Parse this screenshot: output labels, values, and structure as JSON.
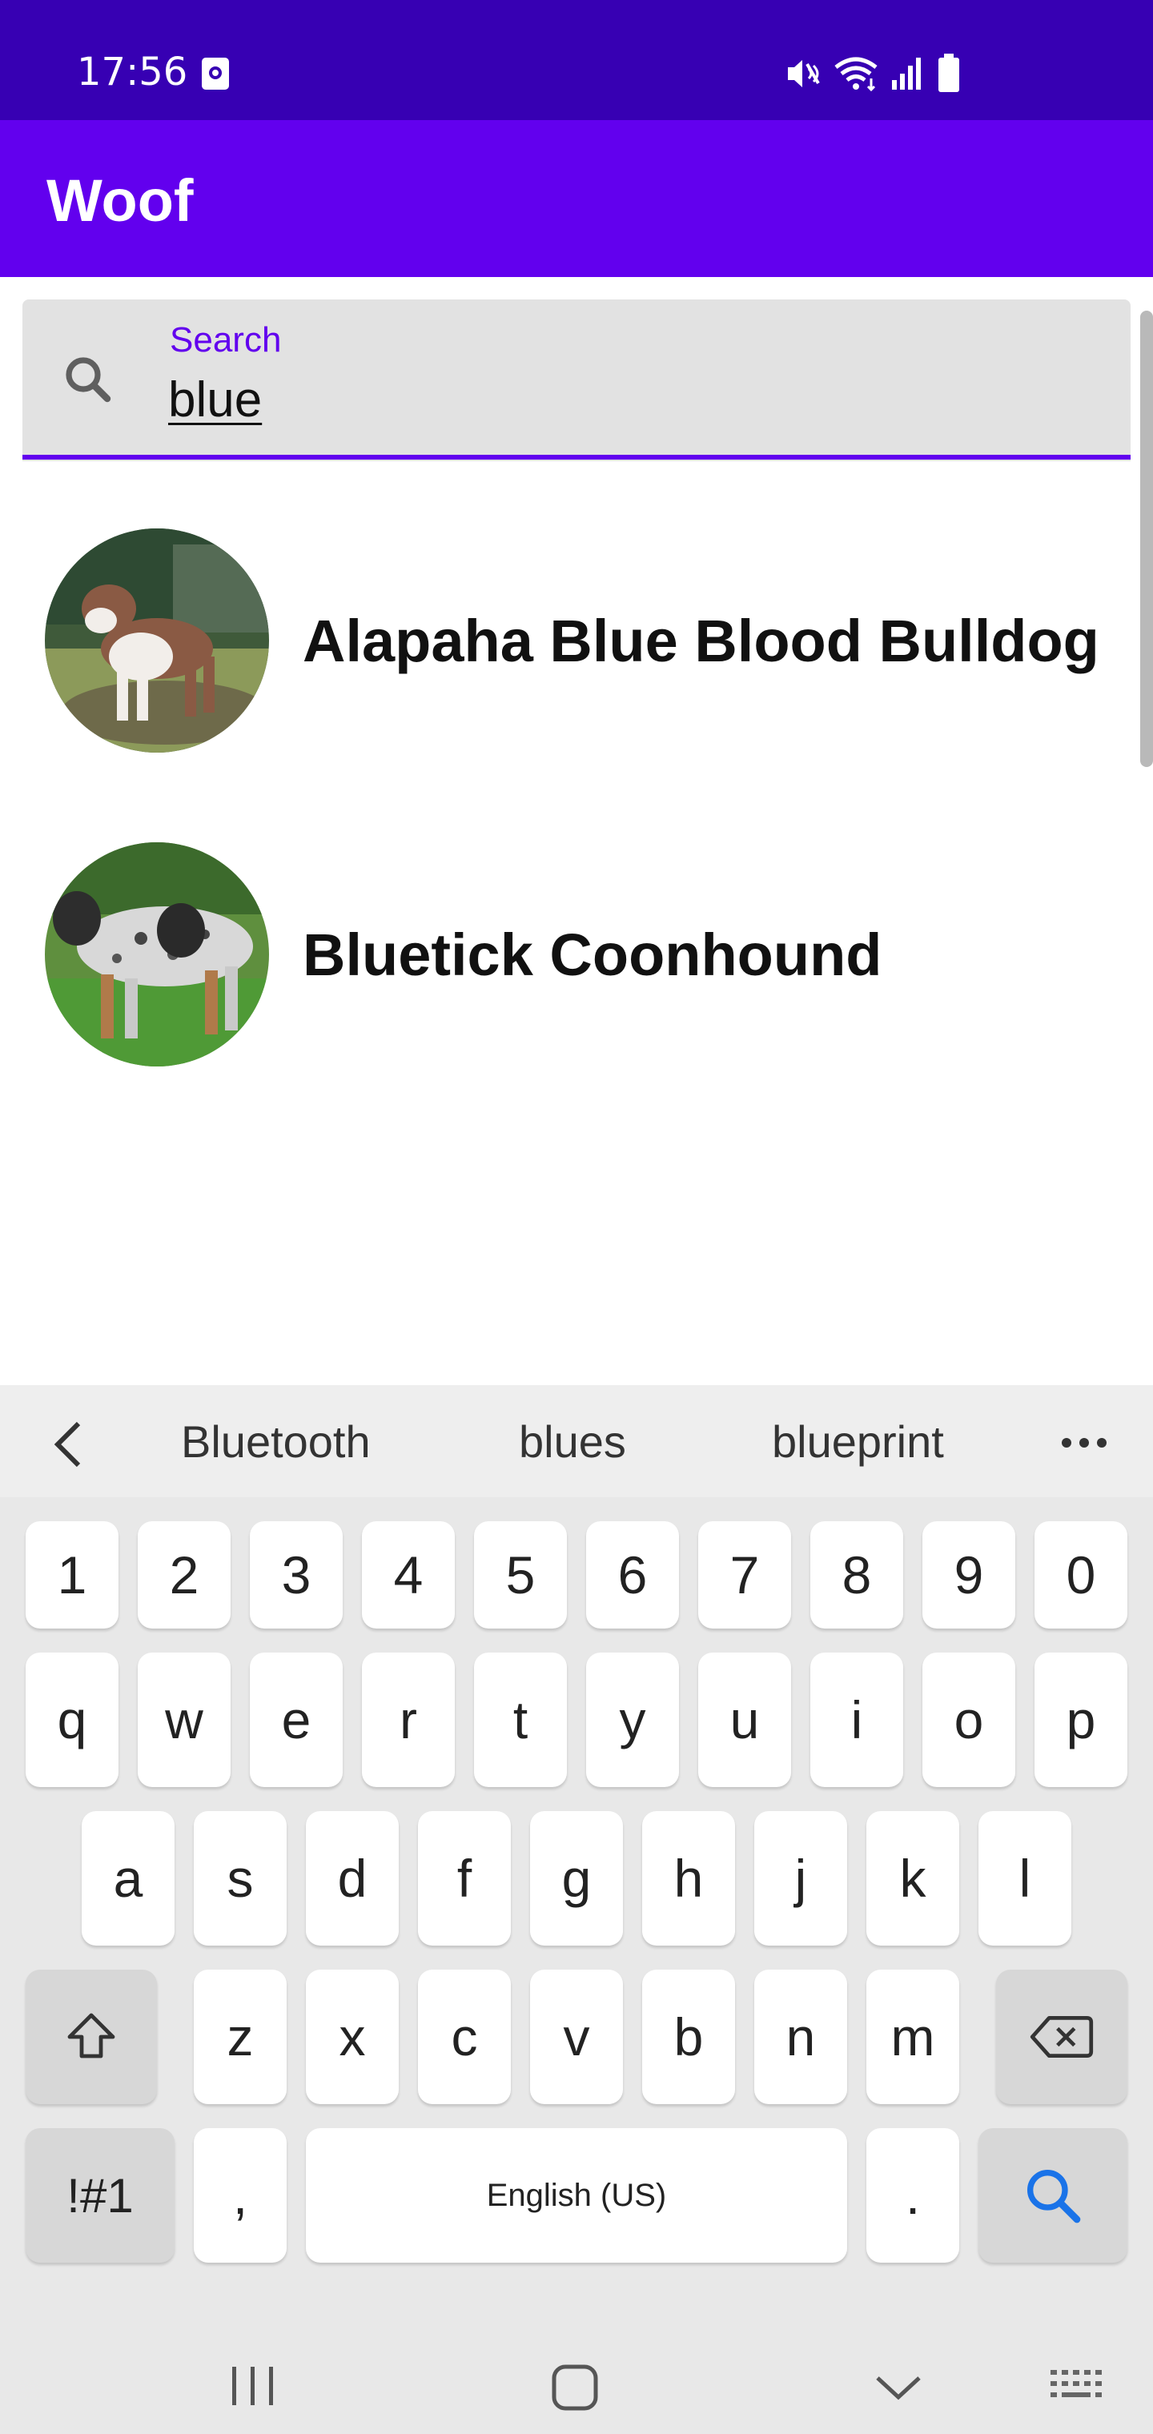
{
  "status_bar": {
    "time": "17:56",
    "icons": [
      "notification-icon",
      "mute-icon",
      "wifi-icon",
      "signal-icon",
      "battery-icon"
    ]
  },
  "app_bar": {
    "title": "Woof"
  },
  "search": {
    "label": "Search",
    "value": "blue",
    "accent_color": "#6200ee"
  },
  "results": [
    {
      "name": "Alapaha Blue Blood Bulldog"
    },
    {
      "name": "Bluetick Coonhound"
    }
  ],
  "keyboard": {
    "suggestions": [
      "Bluetooth",
      "blues",
      "blueprint"
    ],
    "number_row": [
      "1",
      "2",
      "3",
      "4",
      "5",
      "6",
      "7",
      "8",
      "9",
      "0"
    ],
    "row1": [
      "q",
      "w",
      "e",
      "r",
      "t",
      "y",
      "u",
      "i",
      "o",
      "p"
    ],
    "row2": [
      "a",
      "s",
      "d",
      "f",
      "g",
      "h",
      "j",
      "k",
      "l"
    ],
    "row3": [
      "z",
      "x",
      "c",
      "v",
      "b",
      "n",
      "m"
    ],
    "symbols_key": "!#1",
    "comma_key": ",",
    "space_key": "English (US)",
    "period_key": "."
  },
  "colors": {
    "status_bar": "#3700b3",
    "app_bar": "#6200ee",
    "search_action": "#1a73e8"
  }
}
